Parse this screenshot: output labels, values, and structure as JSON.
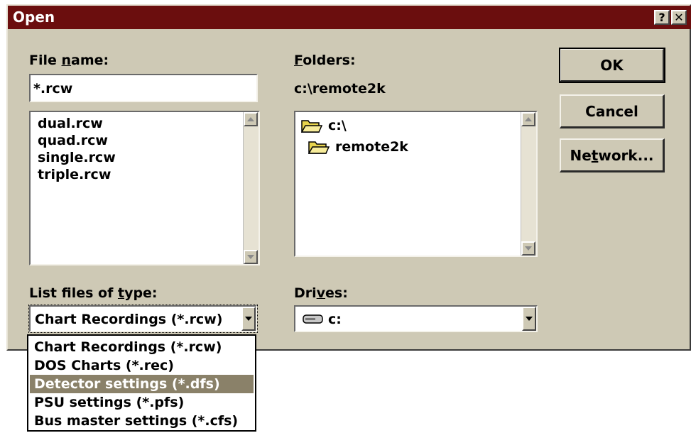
{
  "window": {
    "title": "Open",
    "help_glyph": "?",
    "close_glyph": "✕"
  },
  "file_name": {
    "label": "File name:",
    "value": "*.rcw",
    "files": [
      "dual.rcw",
      "quad.rcw",
      "single.rcw",
      "triple.rcw"
    ]
  },
  "folders": {
    "label": "Folders:",
    "current_path": "c:\\remote2k",
    "tree": [
      "c:\\",
      "remote2k"
    ]
  },
  "buttons": {
    "ok": "OK",
    "cancel": "Cancel",
    "network": "Network..."
  },
  "file_type": {
    "label": "List files of type:",
    "selected": "Chart Recordings (*.rcw)",
    "options": [
      "Chart Recordings (*.rcw)",
      "DOS Charts (*.rec)",
      "Detector settings (*.dfs)",
      "PSU settings (*.pfs)",
      "Bus master settings (*.cfs)"
    ],
    "highlighted_option": "Detector settings (*.dfs)"
  },
  "drives": {
    "label": "Drives:",
    "selected": "c:"
  },
  "colors": {
    "titlebar": "#6b0e0e",
    "dialog_face": "#cec9b5",
    "highlight": "#8a8169"
  },
  "icons": {
    "folder": "open-folder-icon",
    "drive": "hard-drive-icon"
  }
}
